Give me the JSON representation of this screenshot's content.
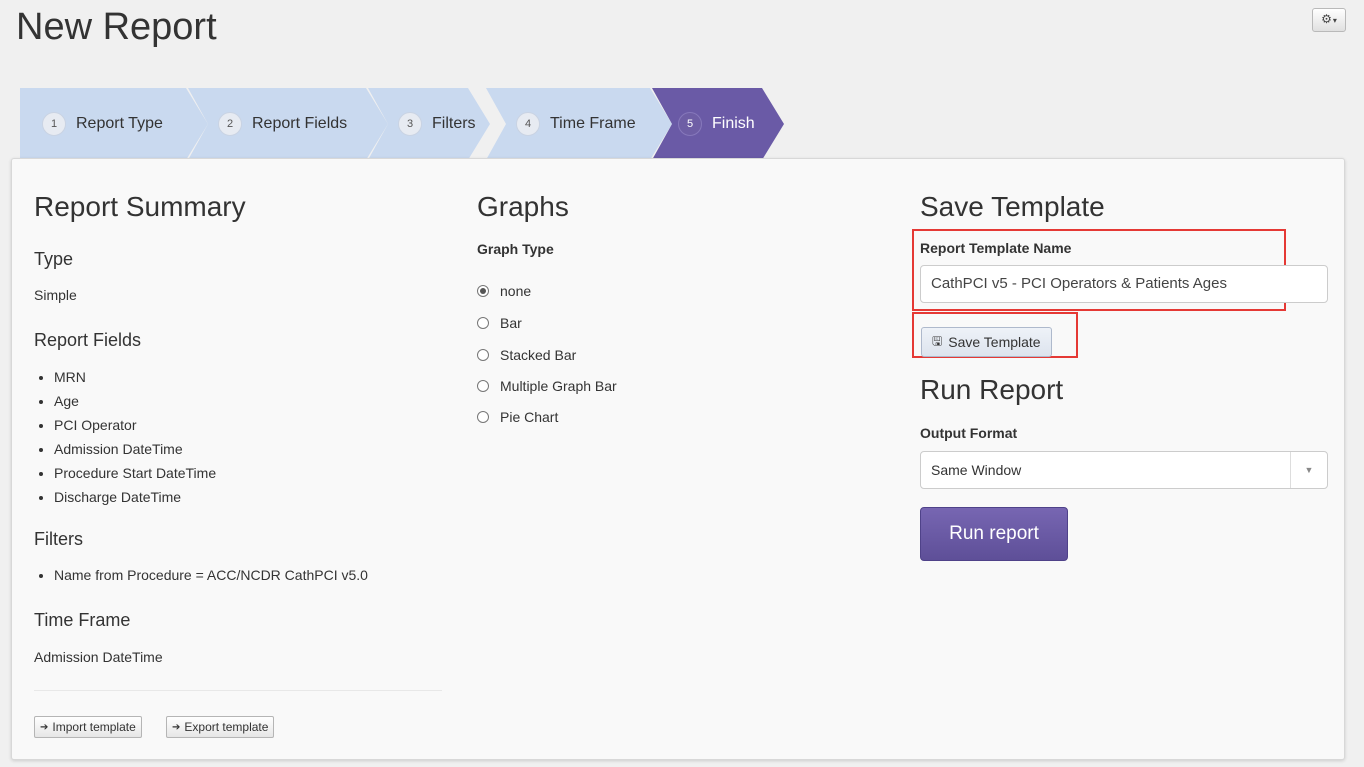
{
  "page": {
    "title": "New Report"
  },
  "toolbar": {
    "gear_icon": "⚙",
    "caret": "▾"
  },
  "wizard": {
    "steps": [
      {
        "num": "1",
        "label": "Report Type",
        "active": false
      },
      {
        "num": "2",
        "label": "Report Fields",
        "active": false
      },
      {
        "num": "3",
        "label": "Filters",
        "active": false
      },
      {
        "num": "4",
        "label": "Time Frame",
        "active": false
      },
      {
        "num": "5",
        "label": "Finish",
        "active": true
      }
    ],
    "colors": {
      "inactive": "#c9d9ef",
      "active": "#6a5aa6"
    }
  },
  "summary": {
    "title": "Report Summary",
    "type_heading": "Type",
    "type_value": "Simple",
    "fields_heading": "Report Fields",
    "fields": [
      "MRN",
      "Age",
      "PCI Operator",
      "Admission DateTime",
      "Procedure Start DateTime",
      "Discharge DateTime"
    ],
    "filters_heading": "Filters",
    "filters": [
      "Name from Procedure = ACC/NCDR CathPCI v5.0"
    ],
    "timeframe_heading": "Time Frame",
    "timeframe_value": "Admission DateTime",
    "import_label": "Import template",
    "export_label": "Export template"
  },
  "graphs": {
    "title": "Graphs",
    "graph_type_label": "Graph Type",
    "options": [
      "none",
      "Bar",
      "Stacked Bar",
      "Multiple Graph Bar",
      "Pie Chart"
    ],
    "selected": "none"
  },
  "save_template": {
    "title": "Save Template",
    "name_label": "Report Template Name",
    "name_value": "CathPCI v5 - PCI Operators & Patients Ages",
    "button_label": "Save Template"
  },
  "run_report": {
    "title": "Run Report",
    "output_label": "Output Format",
    "output_value": "Same Window",
    "button_label": "Run report"
  },
  "colors": {
    "accent": "#6a5aa6",
    "highlight": "#e53935"
  }
}
